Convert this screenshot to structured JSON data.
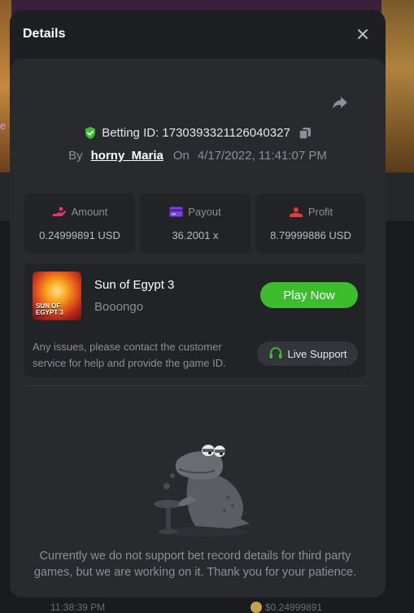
{
  "background": {
    "peek_text": "e",
    "footer_time": "11:38:39 PM",
    "footer_amount": "$0.24999891"
  },
  "modal": {
    "title": "Details",
    "betting_id_label": "Betting ID: 1730393321126040327",
    "by_label": "By",
    "username": "horny_Maria",
    "on_label": "On",
    "timestamp": "4/17/2022, 11:41:07 PM"
  },
  "stats": {
    "amount": {
      "label": "Amount",
      "value": "0.24999891 USD",
      "icon": "amount-icon",
      "color": "#e8356d"
    },
    "payout": {
      "label": "Payout",
      "value": "36.2001 x",
      "icon": "payout-icon",
      "color": "#7b3fe4"
    },
    "profit": {
      "label": "Profit",
      "value": "8.79999886 USD",
      "icon": "profit-icon",
      "color": "#e33b3b"
    }
  },
  "game": {
    "thumb_text_1": "SUN OF",
    "thumb_text_2": "EGYPT 3",
    "name": "Sun of Egypt 3",
    "provider": "Booongo",
    "play_label": "Play Now",
    "issue_text": "Any issues, please contact the customer service for help and provide the game ID.",
    "support_label": "Live Support"
  },
  "empty_state": {
    "message": "Currently we do not support bet record details for third party games, but we are working on it. Thank you for your patience."
  },
  "colors": {
    "accent_green": "#3dbd2e",
    "verified_green": "#3dbd2e"
  }
}
